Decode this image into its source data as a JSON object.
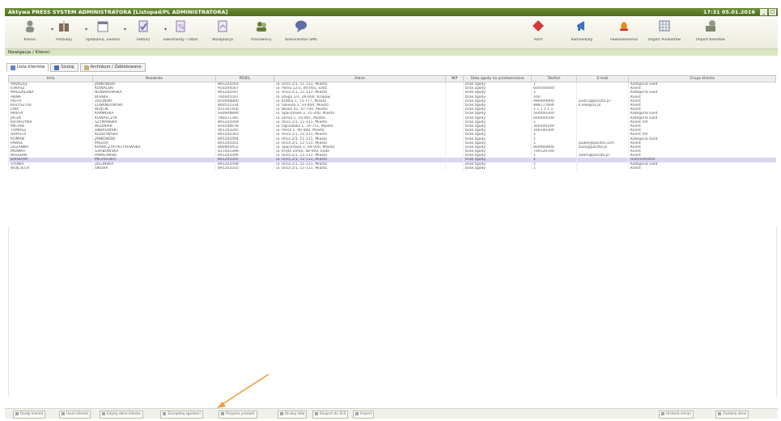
{
  "titlebar": {
    "title": "Aktywa PRESS SYSTEM ADMINISTRATORA [Listopad/PL ADMINISTRATORA]",
    "clock": "17:31 05.01.2016"
  },
  "toolbar": [
    {
      "id": "klienci",
      "label": "Klienci",
      "icon": "people-icon",
      "color": "#8a8f8a",
      "dropdown": true
    },
    {
      "id": "produkty",
      "label": "Produkty",
      "icon": "gift-icon",
      "color": "#7a6b63",
      "dropdown": true
    },
    {
      "id": "kalendarz",
      "label": "Spotkania, Zadania",
      "icon": "calendar-icon",
      "color": "#7b7e99",
      "dropdown": true
    },
    {
      "id": "faktury",
      "label": "Faktury",
      "icon": "check-doc-icon",
      "color": "#7b6fb0",
      "dropdown": true
    },
    {
      "id": "dokumenty",
      "label": "Dokumenty / rabaty",
      "icon": "percent-doc-icon",
      "color": "#8a72b3",
      "dropdown": false
    },
    {
      "id": "raporty",
      "label": "Windykacja",
      "icon": "report-icon",
      "color": "#8570ad",
      "dropdown": false
    },
    {
      "id": "pracownicy",
      "label": "Pracownicy",
      "icon": "users-icon",
      "color": "#5f7a3c",
      "dropdown": false
    },
    {
      "id": "komunikator",
      "label": "Komunikator SMS",
      "icon": "chat-icon",
      "color": "#5a6fa6",
      "dropdown": false
    },
    {
      "id": "alert",
      "label": "Alert",
      "icon": "diamond-icon",
      "color": "#d23a3a",
      "dropdown": false
    },
    {
      "id": "wiadomosci",
      "label": "Komunikaty",
      "icon": "megaphone-icon",
      "color": "#3b73b8",
      "dropdown": false
    },
    {
      "id": "powiadomienia",
      "label": "Powiadomienia",
      "icon": "bell-icon",
      "color": "#e08a1c",
      "dropdown": false
    },
    {
      "id": "import",
      "label": "Import Produktów",
      "icon": "spreadsheet-icon",
      "color": "#6b7a8f",
      "dropdown": false
    },
    {
      "id": "ustawienia",
      "label": "Import Klientów",
      "icon": "settings-icon",
      "color": "#7d8a6e",
      "dropdown": false
    }
  ],
  "breadcrumb": "Nawigacja / Klienci",
  "tabs": [
    {
      "label": "Lista klientów",
      "active": true
    },
    {
      "label": "Szukaj",
      "active": false
    },
    {
      "label": "Archiwum / Zablokowane",
      "active": false
    }
  ],
  "table": {
    "columns": [
      "Imię",
      "Nazwisko",
      "PESEL",
      "Adres",
      "NIP",
      "Data zgody na przetwarzanie",
      "Telefon",
      "E-mail",
      "Grupa klienta"
    ],
    "rows": [
      [
        "ANDRZEJ",
        "JANKOWSKI",
        "891201002",
        "ul. Ulica 2/1, 11-111, Miasto",
        "",
        "brak zgody",
        "1",
        "",
        "Kategoria Gold"
      ],
      [
        "ŁUKASZ",
        "KOWALSKI",
        "950204567",
        "ul. Polna 12/3, 00-001, Łódź",
        "",
        "brak zgody",
        "600500400",
        "",
        "Klient"
      ],
      [
        "MAGDALENA",
        "NOWAKOWSKA",
        "891201007",
        "ul. Ulica 2/1, 11-111, Miasto",
        "",
        "brak zgody",
        "1",
        "",
        "Kategoria Gold"
      ],
      [
        "ANNA",
        "WIŚNIA",
        "760405567",
        "ul. Długa 1/1, 00-000, Kraków",
        "",
        "brak zgody",
        "100",
        "",
        "Klient"
      ],
      [
        "PIOTR",
        "ZIELIŃSKI",
        "850908800",
        "ul. Krótka 1, 73-777, Miasto",
        "",
        "brak zgody",
        "999000900",
        "piotr.z@poczta.pl",
        "Klient"
      ],
      [
        "KRZYSZTOF",
        "LEWANDOWSKI",
        "860512334",
        "ul. Szkolna 1, 33-444, Miasto",
        "",
        "brak zgody",
        "888777666",
        "k.lew@o2.pl",
        "Klient"
      ],
      [
        "EWA",
        "WÓJCIK",
        "921107456",
        "ul. Bliska 41, 47-700, Miasto",
        "",
        "brak zgody",
        "1 1 1 1 1 1",
        "",
        "Klient"
      ],
      [
        "MARTA",
        "KAMIŃSKA",
        "930908890",
        "ul. Spacerowa 3, 35-200, Miasto",
        "",
        "brak zgody",
        "500400300",
        "",
        "Kategoria Gold"
      ],
      [
        "JACEK",
        "KOWALCZYK",
        "780211345",
        "ul. Leśna 1, 10-001, Miasto",
        "",
        "brak zgody",
        "600400500",
        "",
        "Kategoria Gold"
      ],
      [
        "KATARZYNA",
        "SZYMAŃSKA",
        "891201009",
        "ul. Ulica 2/1, 11-111, Miasto",
        "",
        "brak zgody",
        "1",
        "",
        "Klient VIP"
      ],
      [
        "MICHAŁ",
        "WOŹNIAK",
        "850206678",
        "ul. Ogrodowa 1, 70-711, Miasto",
        "",
        "brak zgody",
        "300200100",
        "",
        "Klient"
      ],
      [
        "TOMASZ",
        "DĄBROWSKI",
        "901103245",
        "ul. Polna 1, 90-400, Miasto",
        "",
        "brak zgody",
        "200100300",
        "",
        "Klient"
      ],
      [
        "DOROTA",
        "KOZŁOWSKA",
        "891201003",
        "ul. Ulica 2/1, 11-111, Miasto",
        "",
        "brak zgody",
        "1",
        "",
        "Klient VIP"
      ],
      [
        "ROMAN",
        "JANKOWSKI",
        "891201004",
        "ul. Ulica 2/1, 11-111, Miasto",
        "",
        "brak zgody",
        "1",
        "",
        "Kategoria Gold"
      ],
      [
        "PAWEŁ",
        "MAZUR",
        "891201001",
        "ul. Ulica 2/1, 11-111, Miasto",
        "",
        "brak zgody",
        "1",
        "pawel@poczta.com",
        "Klient"
      ],
      [
        "ZUZANNA",
        "KRAWCZYK-PIOTROWSKA",
        "880904452",
        "ul. Spacerowa 1, 04-000, Miasto",
        "",
        "brak zgody",
        "800900800",
        "zuza@poczta.pl",
        "Klient"
      ],
      [
        "MONIKA",
        "GRABOWSKA",
        "811402396",
        "ul. Kręta 20/40, 48-000, Łódź",
        "",
        "brak zgody",
        "700120700",
        "",
        "Klient"
      ],
      [
        "BOGDAN",
        "PAWŁOWSKI",
        "891201006",
        "ul. Ulica 2/1, 11-111, Miasto",
        "",
        "brak zgody",
        "1",
        "adam@poczta.pl",
        "Klient"
      ],
      [
        "BARBARA",
        "MICHALSKA",
        "891201005",
        "ul. Ulica 2/1, 11-111, Miasto",
        "",
        "brak zgody",
        "1",
        "",
        "Administrator"
      ],
      [
        "SYLWIA",
        "ZIELIŃSKA",
        "891201008",
        "ul. Ulica 2/1, 11-111, Miasto",
        "",
        "brak zgody",
        "1",
        "",
        "Kategoria Gold"
      ],
      [
        "WOJCIECH",
        "SIKORA",
        "891201010",
        "ul. Ulica 2/1, 11-111, Miasto",
        "",
        "brak zgody",
        "1",
        "",
        "Klient"
      ]
    ],
    "selected_row": 18
  },
  "bottom_bar": [
    {
      "label": "Dodaj klienta",
      "icon": "plus-icon"
    },
    {
      "label": "Usuń klienta",
      "icon": "minus-icon"
    },
    {
      "label": "Edytuj dane klienta",
      "icon": "edit-icon"
    },
    {
      "label": "Zarządzaj zgodami",
      "icon": "check-icon"
    },
    {
      "label": "Przypisz produkt",
      "icon": "link-icon"
    },
    {
      "label": "Drukuj listę",
      "icon": "print-icon"
    },
    {
      "label": "Eksport do XLS",
      "icon": "excel-icon"
    },
    {
      "label": "Import",
      "icon": "import-icon"
    },
    {
      "label": "Historia zmian",
      "icon": "history-icon"
    },
    {
      "label": "Zamknij okno",
      "icon": "close-icon"
    }
  ]
}
